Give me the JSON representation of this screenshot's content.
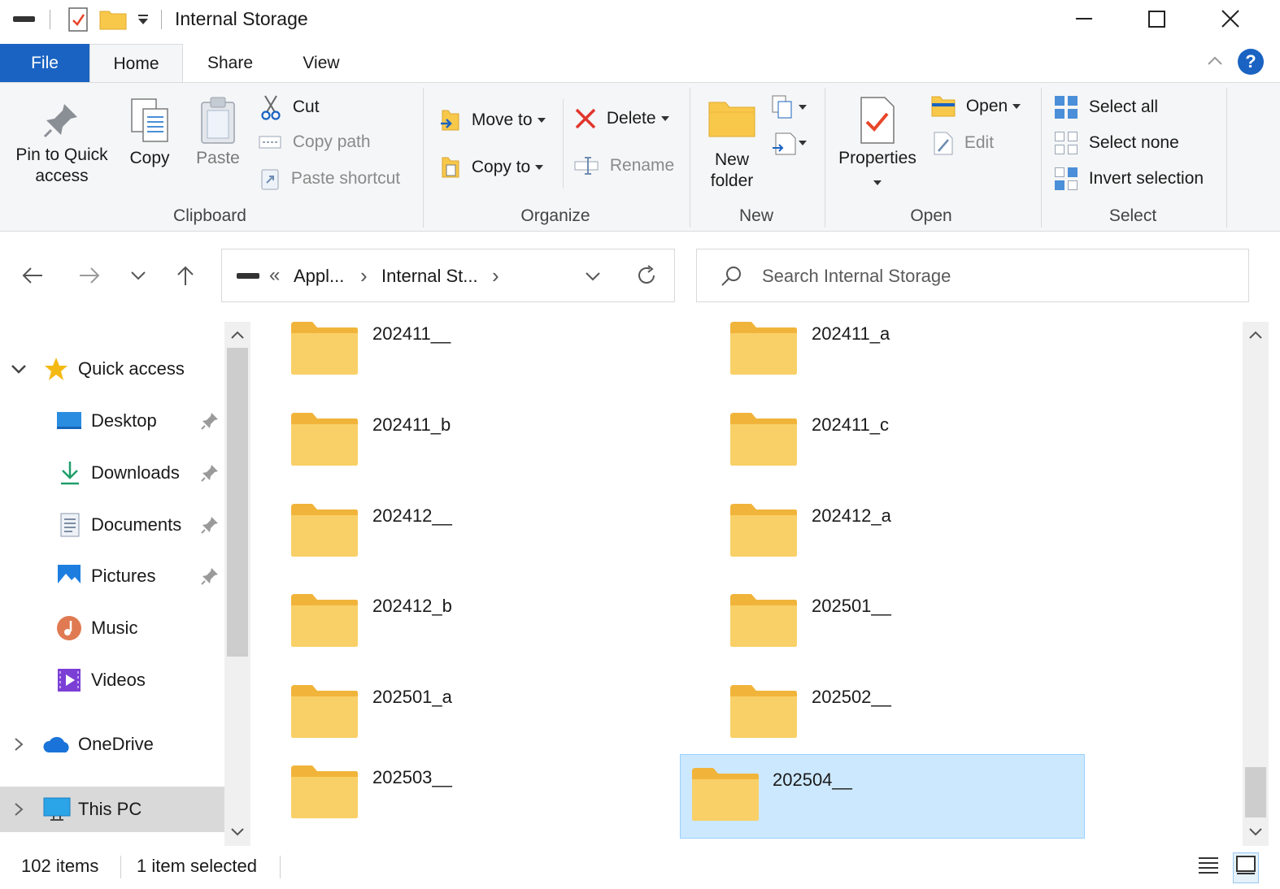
{
  "window": {
    "title": "Internal Storage",
    "minimize_glyph": "—",
    "close_glyph": "✕"
  },
  "tabs": {
    "file": "File",
    "home": "Home",
    "share": "Share",
    "view": "View"
  },
  "ribbon": {
    "clipboard": {
      "label": "Clipboard",
      "pin_line1": "Pin to Quick",
      "pin_line2": "access",
      "copy": "Copy",
      "paste": "Paste",
      "cut": "Cut",
      "copy_path": "Copy path",
      "paste_shortcut": "Paste shortcut"
    },
    "organize": {
      "label": "Organize",
      "move_to": "Move to",
      "copy_to": "Copy to",
      "delete": "Delete",
      "rename": "Rename"
    },
    "new": {
      "label": "New",
      "new_line1": "New",
      "new_line2": "folder"
    },
    "open": {
      "label": "Open",
      "properties": "Properties",
      "open": "Open",
      "edit": "Edit"
    },
    "select": {
      "label": "Select",
      "select_all": "Select all",
      "select_none": "Select none",
      "invert_selection": "Invert selection"
    }
  },
  "address": {
    "overflow": "«",
    "crumb1": "Appl...",
    "crumb2": "Internal St...",
    "sep": "›"
  },
  "search": {
    "placeholder": "Search Internal Storage"
  },
  "sidebar": {
    "quick_access": "Quick access",
    "desktop": "Desktop",
    "downloads": "Downloads",
    "documents": "Documents",
    "pictures": "Pictures",
    "music": "Music",
    "videos": "Videos",
    "onedrive": "OneDrive",
    "this_pc": "This PC"
  },
  "folders": [
    "202411__",
    "202411_a",
    "202411_b",
    "202411_c",
    "202412__",
    "202412_a",
    "202412_b",
    "202501__",
    "202501_a",
    "202502__",
    "202503__",
    "202504__"
  ],
  "status": {
    "items": "102 items",
    "selected": "1 item selected"
  },
  "colors": {
    "accent": "#1a63c2",
    "selection": "#cce8ff",
    "folder": "#f8c84a"
  }
}
